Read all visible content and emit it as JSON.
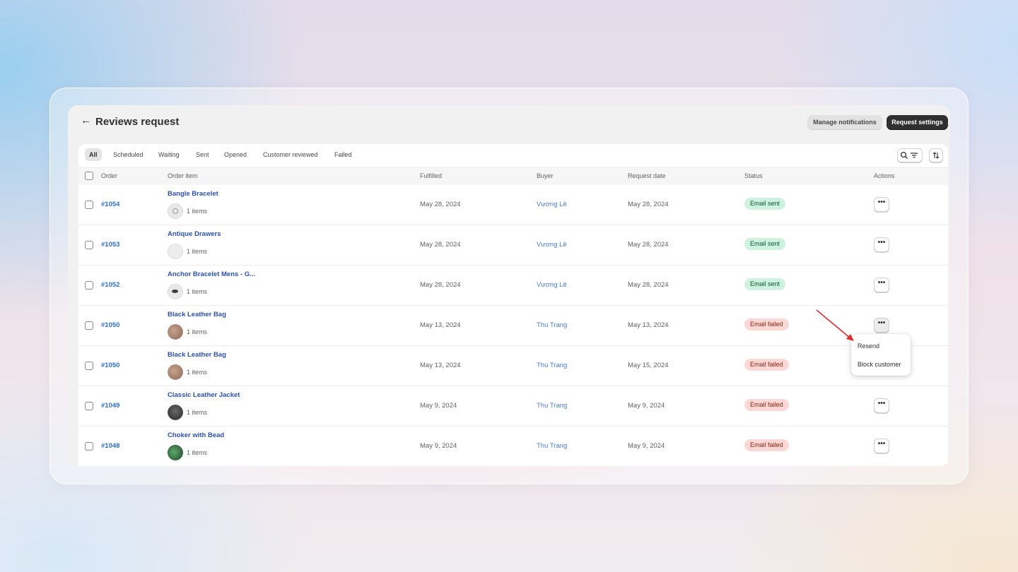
{
  "header": {
    "title": "Reviews request",
    "manage_notifications_label": "Manage notifications",
    "request_settings_label": "Request settings"
  },
  "tabs": [
    {
      "label": "All",
      "active": true
    },
    {
      "label": "Scheduled"
    },
    {
      "label": "Waiting"
    },
    {
      "label": "Sent"
    },
    {
      "label": "Opened"
    },
    {
      "label": "Customer reviewed"
    },
    {
      "label": "Failed"
    }
  ],
  "columns": {
    "order": "Order",
    "order_item": "Order item",
    "fulfilled": "Fulfilled",
    "buyer": "Buyer",
    "request_date": "Request date",
    "status": "Status",
    "actions": "Actions"
  },
  "rows": [
    {
      "order": "#1054",
      "item": "Bangle Bracelet",
      "count": "1 items",
      "fulfilled": "May 28, 2024",
      "buyer": "Vương Lê",
      "request_date": "May 28, 2024",
      "status": "Email sent"
    },
    {
      "order": "#1053",
      "item": "Antique Drawers",
      "count": "1 items",
      "fulfilled": "May 28, 2024",
      "buyer": "Vương Lê",
      "request_date": "May 28, 2024",
      "status": "Email sent"
    },
    {
      "order": "#1052",
      "item": "Anchor Bracelet Mens - G...",
      "count": "1 items",
      "fulfilled": "May 28, 2024",
      "buyer": "Vương Lê",
      "request_date": "May 28, 2024",
      "status": "Email sent"
    },
    {
      "order": "#1050",
      "item": "Black Leather Bag",
      "count": "1 items",
      "fulfilled": "May 13, 2024",
      "buyer": "Thu Trang",
      "request_date": "May 13, 2024",
      "status": "Email failed"
    },
    {
      "order": "#1050",
      "item": "Black Leather Bag",
      "count": "1 items",
      "fulfilled": "May 13, 2024",
      "buyer": "Thu Trang",
      "request_date": "May 15, 2024",
      "status": "Email failed"
    },
    {
      "order": "#1049",
      "item": "Classic Leather Jacket",
      "count": "1 items",
      "fulfilled": "May 9, 2024",
      "buyer": "Thu Trang",
      "request_date": "May 9, 2024",
      "status": "Email failed"
    },
    {
      "order": "#1048",
      "item": "Choker with Bead",
      "count": "1 items",
      "fulfilled": "May 9, 2024",
      "buyer": "Thu Trang",
      "request_date": "May 9, 2024",
      "status": "Email failed"
    }
  ],
  "actions_icon": "•••",
  "row_menu": {
    "resend_label": "Resend",
    "block_label": "Block customer"
  },
  "colors": {
    "primary_button": "#303030",
    "link": "#2c6ecb",
    "status_sent_bg": "#cdf2de",
    "status_failed_bg": "#fbd8d6",
    "annotation_arrow": "#e02b2b"
  }
}
